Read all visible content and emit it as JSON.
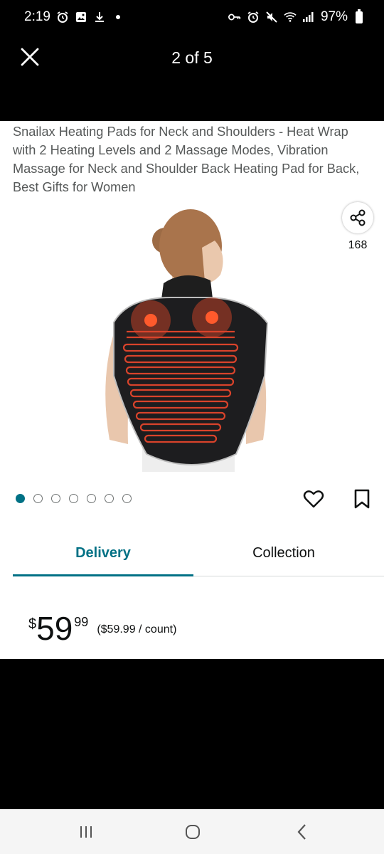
{
  "status_bar": {
    "time": "2:19",
    "battery_percent": "97%",
    "left_icons": [
      "alarm-icon",
      "image-icon",
      "download-icon",
      "dot-icon"
    ],
    "right_icons": [
      "key-icon",
      "alarm-icon",
      "mute-icon",
      "wifi-icon",
      "signal-icon",
      "battery-icon"
    ]
  },
  "viewer": {
    "page_indicator": "2 of 5",
    "close_icon": "close-icon"
  },
  "product": {
    "title": "Snailax Heating Pads for Neck and Shoulders - Heat Wrap with 2 Heating Levels and 2 Massage Modes, Vibration Massage for Neck and Shoulder Back Heating Pad for Back, Best Gifts for Women",
    "share_count": "168",
    "image_index": 1,
    "image_count": 7
  },
  "tabs": [
    {
      "label": "Delivery",
      "selected": true
    },
    {
      "label": "Collection",
      "selected": false
    }
  ],
  "price": {
    "symbol": "$",
    "whole": "59",
    "fraction": "99",
    "unit_price": "($59.99 / count)"
  },
  "colors": {
    "accent": "#007185",
    "text": "#0f1111",
    "muted": "#565959"
  }
}
